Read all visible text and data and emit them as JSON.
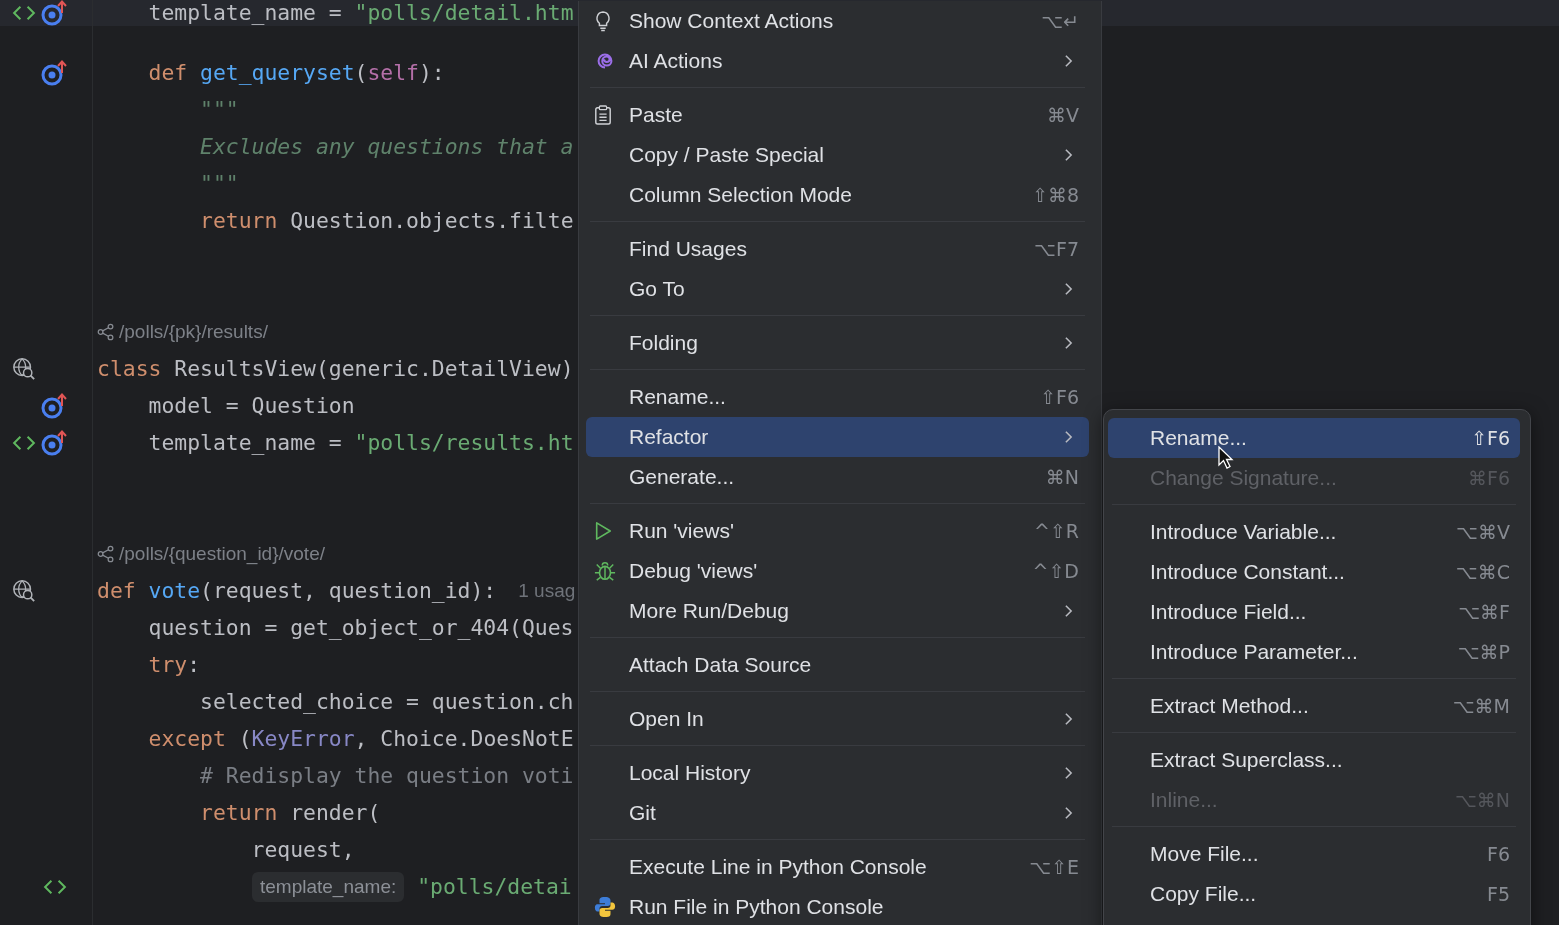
{
  "editor": {
    "lines": [
      {
        "kind": "code",
        "parts": [
          {
            "kind": "code",
            "tokens": [
              {
                "t": "    template_name = ",
                "kind": "plain"
              },
              {
                "t": "\"polls/detail.htm",
                "kind": "string"
              }
            ]
          }
        ]
      },
      {
        "kind": "blank"
      },
      {
        "kind": "code",
        "parts": [
          {
            "kind": "code",
            "tokens": [
              {
                "t": "    def ",
                "kind": "keyword"
              },
              {
                "t": "get_queryset",
                "kind": "function"
              },
              {
                "t": "(",
                "kind": "plain"
              },
              {
                "t": "self",
                "kind": "self"
              },
              {
                "t": "):",
                "kind": "plain"
              }
            ]
          }
        ]
      },
      {
        "kind": "code",
        "parts": [
          {
            "kind": "code",
            "tokens": [
              {
                "t": "        \"\"\"",
                "kind": "docstring"
              }
            ]
          }
        ]
      },
      {
        "kind": "code",
        "parts": [
          {
            "kind": "code",
            "tokens": [
              {
                "t": "        Excludes any questions that a",
                "kind": "docstring"
              }
            ]
          }
        ]
      },
      {
        "kind": "code",
        "parts": [
          {
            "kind": "code",
            "tokens": [
              {
                "t": "        \"\"\"",
                "kind": "docstring"
              }
            ]
          }
        ]
      },
      {
        "kind": "code",
        "parts": [
          {
            "kind": "code",
            "tokens": [
              {
                "t": "        return ",
                "kind": "keyword"
              },
              {
                "t": "Question.objects.filte",
                "kind": "plain"
              }
            ]
          }
        ]
      },
      {
        "kind": "blank"
      },
      {
        "kind": "blank"
      },
      {
        "kind": "code",
        "parts": [
          {
            "kind": "route",
            "text": "/polls/{pk}/results/"
          }
        ]
      },
      {
        "kind": "code",
        "parts": [
          {
            "kind": "code",
            "tokens": [
              {
                "t": "class ",
                "kind": "keyword"
              },
              {
                "t": "ResultsView(generic.DetailView)",
                "kind": "plain"
              }
            ]
          }
        ]
      },
      {
        "kind": "code",
        "parts": [
          {
            "kind": "code",
            "tokens": [
              {
                "t": "    model = Question",
                "kind": "plain"
              }
            ]
          }
        ]
      },
      {
        "kind": "code",
        "parts": [
          {
            "kind": "code",
            "tokens": [
              {
                "t": "    template_name = ",
                "kind": "plain"
              },
              {
                "t": "\"polls/results.ht",
                "kind": "string"
              }
            ]
          }
        ]
      },
      {
        "kind": "blank"
      },
      {
        "kind": "blank"
      },
      {
        "kind": "code",
        "parts": [
          {
            "kind": "route",
            "text": "/polls/{question_id}/vote/"
          }
        ]
      },
      {
        "kind": "code",
        "parts": [
          {
            "kind": "code",
            "tokens": [
              {
                "t": "def ",
                "kind": "keyword"
              },
              {
                "t": "vote",
                "kind": "function"
              },
              {
                "t": "(request, question_id):",
                "kind": "plain"
              }
            ]
          },
          {
            "kind": "usage_hint",
            "text": "1 usag"
          }
        ]
      },
      {
        "kind": "code",
        "parts": [
          {
            "kind": "code",
            "tokens": [
              {
                "t": "    question = get_object_or_404(Ques",
                "kind": "plain"
              }
            ]
          }
        ]
      },
      {
        "kind": "code",
        "parts": [
          {
            "kind": "code",
            "tokens": [
              {
                "t": "    try",
                "kind": "keyword"
              },
              {
                "t": ":",
                "kind": "plain"
              }
            ]
          }
        ]
      },
      {
        "kind": "code",
        "parts": [
          {
            "kind": "code",
            "tokens": [
              {
                "t": "        selected_choice = question.ch",
                "kind": "plain"
              }
            ]
          }
        ]
      },
      {
        "kind": "code",
        "parts": [
          {
            "kind": "code",
            "tokens": [
              {
                "t": "    except ",
                "kind": "keyword"
              },
              {
                "t": "(",
                "kind": "plain"
              },
              {
                "t": "KeyError",
                "kind": "builtin"
              },
              {
                "t": ", Choice.DoesNotE",
                "kind": "plain"
              }
            ]
          }
        ]
      },
      {
        "kind": "code",
        "parts": [
          {
            "kind": "code",
            "tokens": [
              {
                "t": "        # Redisplay the question voti",
                "kind": "comment"
              }
            ]
          }
        ]
      },
      {
        "kind": "code",
        "parts": [
          {
            "kind": "code",
            "tokens": [
              {
                "t": "        return ",
                "kind": "keyword"
              },
              {
                "t": "render(",
                "kind": "plain"
              }
            ]
          }
        ]
      },
      {
        "kind": "code",
        "parts": [
          {
            "kind": "code",
            "tokens": [
              {
                "t": "            request,",
                "kind": "plain"
              }
            ]
          }
        ]
      },
      {
        "kind": "code",
        "parts": [
          {
            "kind": "param_hint",
            "text": "template_name:"
          },
          {
            "kind": "code",
            "tokens": [
              {
                "t": " \"polls/detai",
                "kind": "string"
              }
            ]
          }
        ]
      }
    ]
  },
  "context_menu": {
    "items": [
      {
        "kind": "item",
        "label": "Show Context Actions",
        "shortcut": "⌥↵",
        "submenu": false,
        "selected": false,
        "disabled": false
      },
      {
        "kind": "item",
        "label": "AI Actions",
        "submenu": true,
        "selected": false,
        "disabled": false
      },
      {
        "kind": "separator"
      },
      {
        "kind": "item",
        "label": "Paste",
        "shortcut": "⌘V",
        "submenu": false,
        "selected": false,
        "disabled": false
      },
      {
        "kind": "item",
        "label": "Copy / Paste Special",
        "submenu": true,
        "selected": false,
        "disabled": false
      },
      {
        "kind": "item",
        "label": "Column Selection Mode",
        "shortcut": "⇧⌘8",
        "submenu": false,
        "selected": false,
        "disabled": false
      },
      {
        "kind": "separator"
      },
      {
        "kind": "item",
        "label": "Find Usages",
        "shortcut": "⌥F7",
        "submenu": false,
        "selected": false,
        "disabled": false
      },
      {
        "kind": "item",
        "label": "Go To",
        "submenu": true,
        "selected": false,
        "disabled": false
      },
      {
        "kind": "separator"
      },
      {
        "kind": "item",
        "label": "Folding",
        "submenu": true,
        "selected": false,
        "disabled": false
      },
      {
        "kind": "separator"
      },
      {
        "kind": "item",
        "label": "Rename...",
        "shortcut": "⇧F6",
        "submenu": false,
        "selected": false,
        "disabled": false
      },
      {
        "kind": "item",
        "label": "Refactor",
        "submenu": true,
        "selected": true,
        "disabled": false
      },
      {
        "kind": "item",
        "label": "Generate...",
        "shortcut": "⌘N",
        "submenu": false,
        "selected": false,
        "disabled": false
      },
      {
        "kind": "separator"
      },
      {
        "kind": "item",
        "label": "Run 'views'",
        "shortcut": "^⇧R",
        "submenu": false,
        "selected": false,
        "disabled": false
      },
      {
        "kind": "item",
        "label": "Debug 'views'",
        "shortcut": "^⇧D",
        "submenu": false,
        "selected": false,
        "disabled": false
      },
      {
        "kind": "item",
        "label": "More Run/Debug",
        "submenu": true,
        "selected": false,
        "disabled": false
      },
      {
        "kind": "separator"
      },
      {
        "kind": "item",
        "label": "Attach Data Source",
        "submenu": false,
        "selected": false,
        "disabled": false
      },
      {
        "kind": "separator"
      },
      {
        "kind": "item",
        "label": "Open In",
        "submenu": true,
        "selected": false,
        "disabled": false
      },
      {
        "kind": "separator"
      },
      {
        "kind": "item",
        "label": "Local History",
        "submenu": true,
        "selected": false,
        "disabled": false
      },
      {
        "kind": "item",
        "label": "Git",
        "submenu": true,
        "selected": false,
        "disabled": false
      },
      {
        "kind": "separator"
      },
      {
        "kind": "item",
        "label": "Execute Line in Python Console",
        "shortcut": "⌥⇧E",
        "submenu": false,
        "selected": false,
        "disabled": false
      },
      {
        "kind": "item",
        "label": "Run File in Python Console",
        "submenu": false,
        "selected": false,
        "disabled": false
      }
    ]
  },
  "refactor_submenu": {
    "items": [
      {
        "kind": "item",
        "label": "Rename...",
        "shortcut": "⇧F6",
        "selected": true,
        "disabled": false
      },
      {
        "kind": "item",
        "label": "Change Signature...",
        "shortcut": "⌘F6",
        "selected": false,
        "disabled": true
      },
      {
        "kind": "separator"
      },
      {
        "kind": "item",
        "label": "Introduce Variable...",
        "shortcut": "⌥⌘V",
        "selected": false,
        "disabled": false
      },
      {
        "kind": "item",
        "label": "Introduce Constant...",
        "shortcut": "⌥⌘C",
        "selected": false,
        "disabled": false
      },
      {
        "kind": "item",
        "label": "Introduce Field...",
        "shortcut": "⌥⌘F",
        "selected": false,
        "disabled": false
      },
      {
        "kind": "item",
        "label": "Introduce Parameter...",
        "shortcut": "⌥⌘P",
        "selected": false,
        "disabled": false
      },
      {
        "kind": "separator"
      },
      {
        "kind": "item",
        "label": "Extract Method...",
        "shortcut": "⌥⌘M",
        "selected": false,
        "disabled": false
      },
      {
        "kind": "separator"
      },
      {
        "kind": "item",
        "label": "Extract Superclass...",
        "selected": false,
        "disabled": false
      },
      {
        "kind": "item",
        "label": "Inline...",
        "shortcut": "⌥⌘N",
        "selected": false,
        "disabled": true
      },
      {
        "kind": "separator"
      },
      {
        "kind": "item",
        "label": "Move File...",
        "shortcut": "F6",
        "selected": false,
        "disabled": false
      },
      {
        "kind": "item",
        "label": "Copy File...",
        "shortcut": "F5",
        "selected": false,
        "disabled": false
      }
    ]
  }
}
